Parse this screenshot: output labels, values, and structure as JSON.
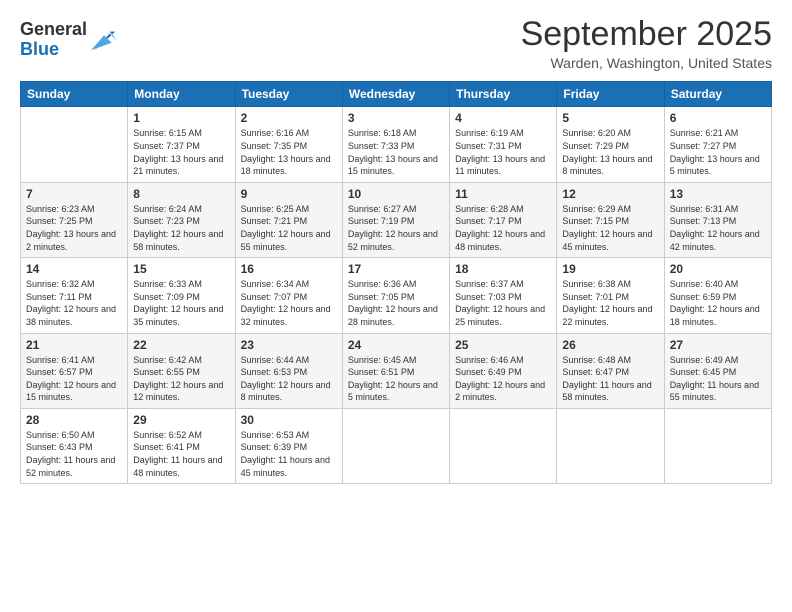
{
  "header": {
    "logo": {
      "general": "General",
      "blue": "Blue"
    },
    "month": "September 2025",
    "location": "Warden, Washington, United States"
  },
  "weekdays": [
    "Sunday",
    "Monday",
    "Tuesday",
    "Wednesday",
    "Thursday",
    "Friday",
    "Saturday"
  ],
  "weeks": [
    [
      {
        "day": "",
        "sunrise": "",
        "sunset": "",
        "daylight": ""
      },
      {
        "day": "1",
        "sunrise": "Sunrise: 6:15 AM",
        "sunset": "Sunset: 7:37 PM",
        "daylight": "Daylight: 13 hours and 21 minutes."
      },
      {
        "day": "2",
        "sunrise": "Sunrise: 6:16 AM",
        "sunset": "Sunset: 7:35 PM",
        "daylight": "Daylight: 13 hours and 18 minutes."
      },
      {
        "day": "3",
        "sunrise": "Sunrise: 6:18 AM",
        "sunset": "Sunset: 7:33 PM",
        "daylight": "Daylight: 13 hours and 15 minutes."
      },
      {
        "day": "4",
        "sunrise": "Sunrise: 6:19 AM",
        "sunset": "Sunset: 7:31 PM",
        "daylight": "Daylight: 13 hours and 11 minutes."
      },
      {
        "day": "5",
        "sunrise": "Sunrise: 6:20 AM",
        "sunset": "Sunset: 7:29 PM",
        "daylight": "Daylight: 13 hours and 8 minutes."
      },
      {
        "day": "6",
        "sunrise": "Sunrise: 6:21 AM",
        "sunset": "Sunset: 7:27 PM",
        "daylight": "Daylight: 13 hours and 5 minutes."
      }
    ],
    [
      {
        "day": "7",
        "sunrise": "Sunrise: 6:23 AM",
        "sunset": "Sunset: 7:25 PM",
        "daylight": "Daylight: 13 hours and 2 minutes."
      },
      {
        "day": "8",
        "sunrise": "Sunrise: 6:24 AM",
        "sunset": "Sunset: 7:23 PM",
        "daylight": "Daylight: 12 hours and 58 minutes."
      },
      {
        "day": "9",
        "sunrise": "Sunrise: 6:25 AM",
        "sunset": "Sunset: 7:21 PM",
        "daylight": "Daylight: 12 hours and 55 minutes."
      },
      {
        "day": "10",
        "sunrise": "Sunrise: 6:27 AM",
        "sunset": "Sunset: 7:19 PM",
        "daylight": "Daylight: 12 hours and 52 minutes."
      },
      {
        "day": "11",
        "sunrise": "Sunrise: 6:28 AM",
        "sunset": "Sunset: 7:17 PM",
        "daylight": "Daylight: 12 hours and 48 minutes."
      },
      {
        "day": "12",
        "sunrise": "Sunrise: 6:29 AM",
        "sunset": "Sunset: 7:15 PM",
        "daylight": "Daylight: 12 hours and 45 minutes."
      },
      {
        "day": "13",
        "sunrise": "Sunrise: 6:31 AM",
        "sunset": "Sunset: 7:13 PM",
        "daylight": "Daylight: 12 hours and 42 minutes."
      }
    ],
    [
      {
        "day": "14",
        "sunrise": "Sunrise: 6:32 AM",
        "sunset": "Sunset: 7:11 PM",
        "daylight": "Daylight: 12 hours and 38 minutes."
      },
      {
        "day": "15",
        "sunrise": "Sunrise: 6:33 AM",
        "sunset": "Sunset: 7:09 PM",
        "daylight": "Daylight: 12 hours and 35 minutes."
      },
      {
        "day": "16",
        "sunrise": "Sunrise: 6:34 AM",
        "sunset": "Sunset: 7:07 PM",
        "daylight": "Daylight: 12 hours and 32 minutes."
      },
      {
        "day": "17",
        "sunrise": "Sunrise: 6:36 AM",
        "sunset": "Sunset: 7:05 PM",
        "daylight": "Daylight: 12 hours and 28 minutes."
      },
      {
        "day": "18",
        "sunrise": "Sunrise: 6:37 AM",
        "sunset": "Sunset: 7:03 PM",
        "daylight": "Daylight: 12 hours and 25 minutes."
      },
      {
        "day": "19",
        "sunrise": "Sunrise: 6:38 AM",
        "sunset": "Sunset: 7:01 PM",
        "daylight": "Daylight: 12 hours and 22 minutes."
      },
      {
        "day": "20",
        "sunrise": "Sunrise: 6:40 AM",
        "sunset": "Sunset: 6:59 PM",
        "daylight": "Daylight: 12 hours and 18 minutes."
      }
    ],
    [
      {
        "day": "21",
        "sunrise": "Sunrise: 6:41 AM",
        "sunset": "Sunset: 6:57 PM",
        "daylight": "Daylight: 12 hours and 15 minutes."
      },
      {
        "day": "22",
        "sunrise": "Sunrise: 6:42 AM",
        "sunset": "Sunset: 6:55 PM",
        "daylight": "Daylight: 12 hours and 12 minutes."
      },
      {
        "day": "23",
        "sunrise": "Sunrise: 6:44 AM",
        "sunset": "Sunset: 6:53 PM",
        "daylight": "Daylight: 12 hours and 8 minutes."
      },
      {
        "day": "24",
        "sunrise": "Sunrise: 6:45 AM",
        "sunset": "Sunset: 6:51 PM",
        "daylight": "Daylight: 12 hours and 5 minutes."
      },
      {
        "day": "25",
        "sunrise": "Sunrise: 6:46 AM",
        "sunset": "Sunset: 6:49 PM",
        "daylight": "Daylight: 12 hours and 2 minutes."
      },
      {
        "day": "26",
        "sunrise": "Sunrise: 6:48 AM",
        "sunset": "Sunset: 6:47 PM",
        "daylight": "Daylight: 11 hours and 58 minutes."
      },
      {
        "day": "27",
        "sunrise": "Sunrise: 6:49 AM",
        "sunset": "Sunset: 6:45 PM",
        "daylight": "Daylight: 11 hours and 55 minutes."
      }
    ],
    [
      {
        "day": "28",
        "sunrise": "Sunrise: 6:50 AM",
        "sunset": "Sunset: 6:43 PM",
        "daylight": "Daylight: 11 hours and 52 minutes."
      },
      {
        "day": "29",
        "sunrise": "Sunrise: 6:52 AM",
        "sunset": "Sunset: 6:41 PM",
        "daylight": "Daylight: 11 hours and 48 minutes."
      },
      {
        "day": "30",
        "sunrise": "Sunrise: 6:53 AM",
        "sunset": "Sunset: 6:39 PM",
        "daylight": "Daylight: 11 hours and 45 minutes."
      },
      {
        "day": "",
        "sunrise": "",
        "sunset": "",
        "daylight": ""
      },
      {
        "day": "",
        "sunrise": "",
        "sunset": "",
        "daylight": ""
      },
      {
        "day": "",
        "sunrise": "",
        "sunset": "",
        "daylight": ""
      },
      {
        "day": "",
        "sunrise": "",
        "sunset": "",
        "daylight": ""
      }
    ]
  ]
}
